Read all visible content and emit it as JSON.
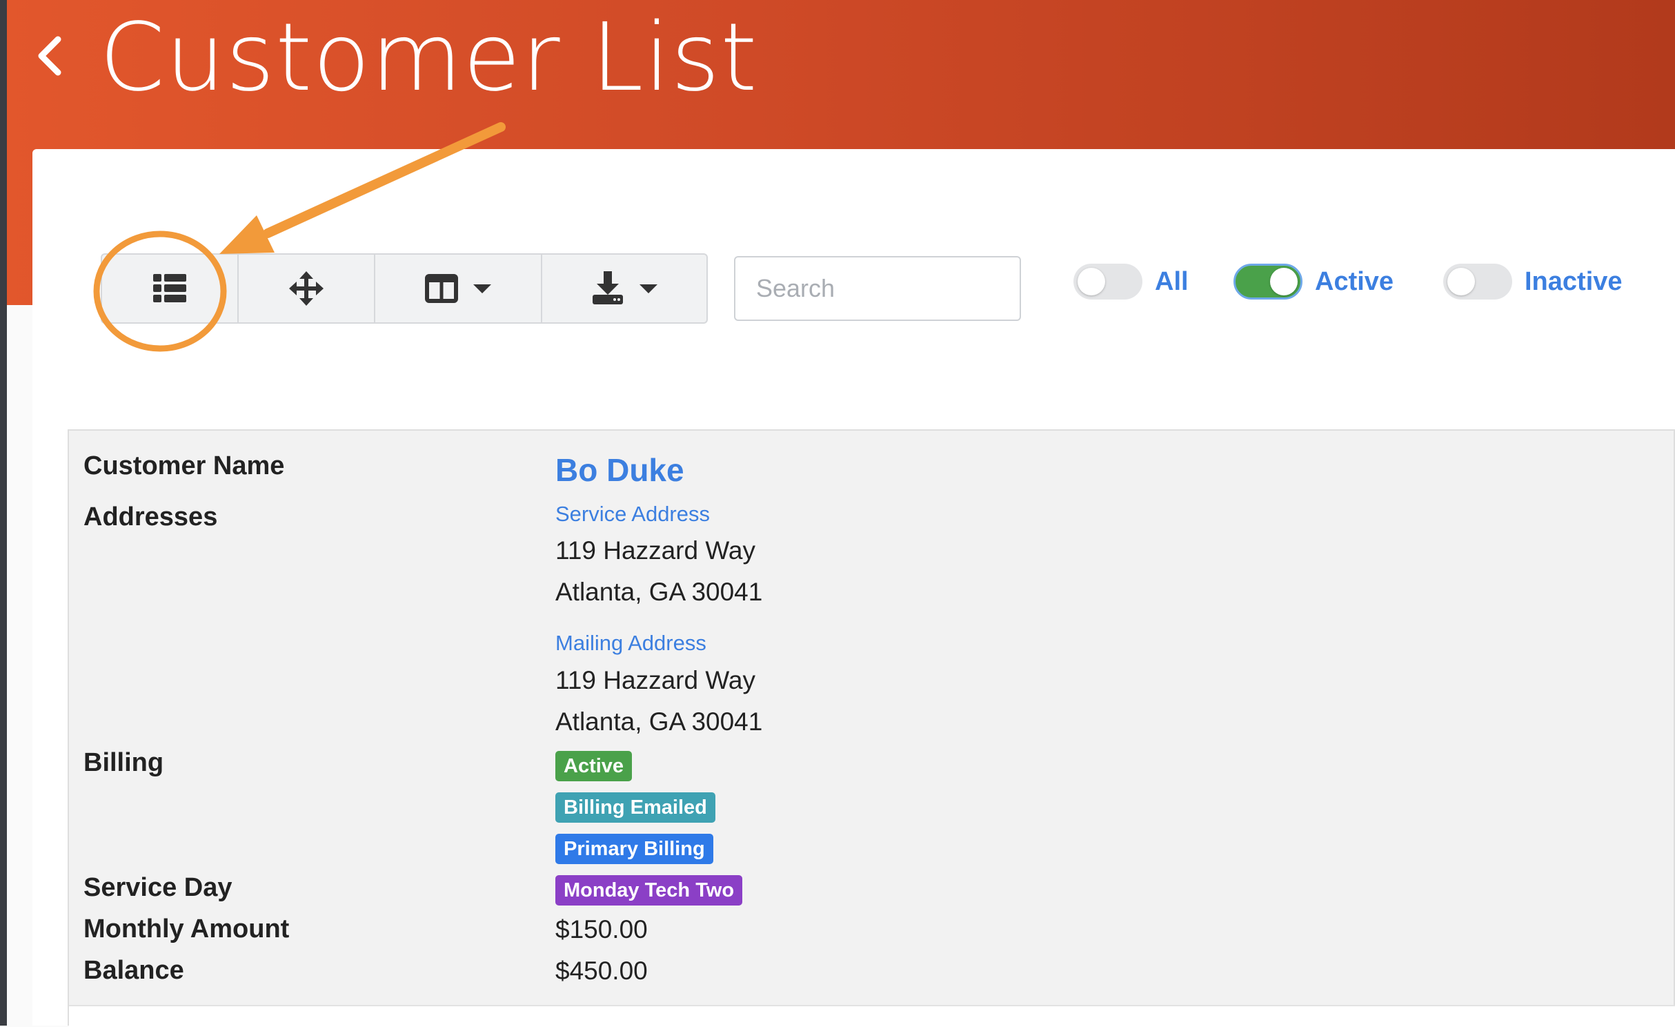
{
  "header": {
    "title": "Customer List",
    "back_icon": "chevron-left-icon",
    "color_start": "#e2572c",
    "color_end": "#b23a1c"
  },
  "toolbar": {
    "buttons": [
      {
        "icon": "list-view-icon"
      },
      {
        "icon": "move-arrows-icon"
      },
      {
        "icon": "columns-icon",
        "dropdown": true
      },
      {
        "icon": "download-icon",
        "dropdown": true
      }
    ],
    "search_placeholder": "Search"
  },
  "filters": [
    {
      "label": "All",
      "on": false
    },
    {
      "label": "Active",
      "on": true
    },
    {
      "label": "Inactive",
      "on": false
    }
  ],
  "customer": {
    "labels": {
      "name": "Customer Name",
      "addresses": "Addresses",
      "billing": "Billing",
      "service_day": "Service Day",
      "monthly_amount": "Monthly Amount",
      "balance": "Balance"
    },
    "name": "Bo Duke",
    "service_address": {
      "title": "Service Address",
      "line1": "119 Hazzard Way",
      "line2": "Atlanta, GA 30041"
    },
    "mailing_address": {
      "title": "Mailing Address",
      "line1": "119 Hazzard Way",
      "line2": "Atlanta, GA 30041"
    },
    "billing_badges": [
      {
        "label": "Active",
        "color": "#4aa14a"
      },
      {
        "label": "Billing Emailed",
        "color": "#3fa2b3"
      },
      {
        "label": "Primary Billing",
        "color": "#2f7ae8"
      }
    ],
    "service_day_badge": {
      "label": "Monday Tech Two",
      "color": "#8b3fc6"
    },
    "monthly_amount": "$150.00",
    "balance": "$450.00"
  },
  "annotation_color": "#f29a3a"
}
